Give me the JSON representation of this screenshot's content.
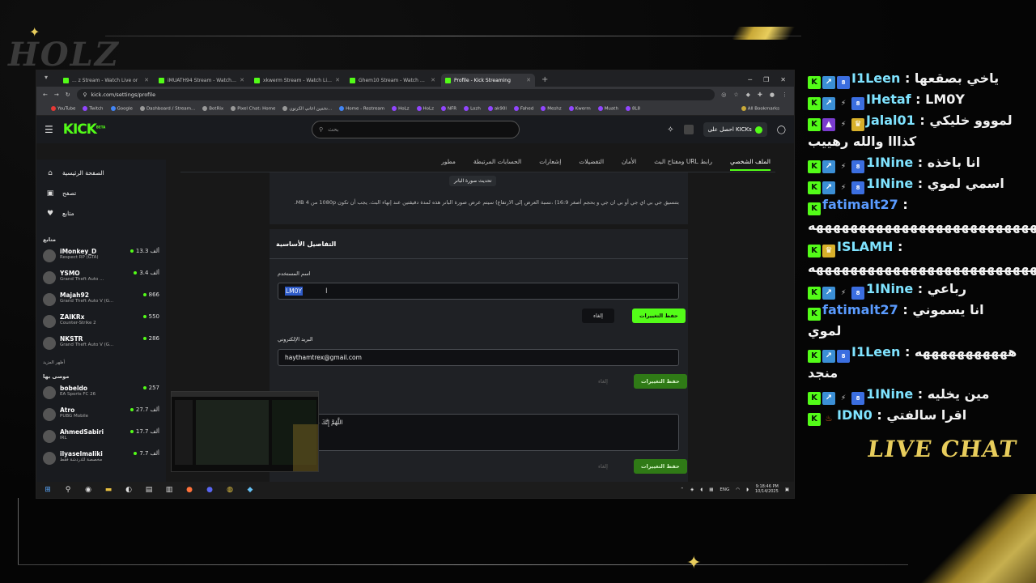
{
  "overlay": {
    "streamer_logo": "HOLZ",
    "live_chat_label": "LIVE CHAT",
    "accent_gold": "#e8cd5c"
  },
  "browser": {
    "tabs": [
      {
        "label": "... z Stream - Watch Live or",
        "active": false
      },
      {
        "label": "iMUATH94 Stream - Watch Live",
        "active": false
      },
      {
        "label": "xkwerm Stream - Watch Live o",
        "active": false
      },
      {
        "label": "Ghem10 Stream - Watch Live o",
        "active": false
      },
      {
        "label": "Profile - Kick Streaming",
        "active": true
      }
    ],
    "new_tab": "+",
    "url": "kick.com/settings/profile",
    "bookmarks": [
      "YouTube",
      "Twitch",
      "Google",
      "Dashboard / Stream...",
      "BotRix",
      "Pixel Chat: Home",
      "تخمين اغاني الكرتون...",
      "Home - Restream",
      "HoLz",
      "HoLz",
      "NFR",
      "Lozh",
      "ak90l",
      "Fahed",
      "Meshz",
      "Kwerm",
      "Muath",
      "8L8",
      "All Bookmarks"
    ]
  },
  "kick": {
    "logo": "KICK",
    "logo_sup": "BETA",
    "search_placeholder": "بحث",
    "get_kicks": "احصل على KICKs",
    "brand_color": "#53fc18",
    "sidebar": {
      "nav": [
        {
          "icon": "home-icon",
          "glyph": "⌂",
          "label": "الصفحة الرئيسية"
        },
        {
          "icon": "browse-icon",
          "glyph": "▣",
          "label": "تصفح"
        },
        {
          "icon": "following-icon",
          "glyph": "♥",
          "label": "متابع"
        }
      ],
      "following_title": "متابع",
      "following": [
        {
          "name": "iMonkey_D",
          "game": "Respect RP (GTA)",
          "viewers": "13.3 ألف"
        },
        {
          "name": "YSMO",
          "game": "Grand Theft Auto ...",
          "viewers": "3.4 ألف"
        },
        {
          "name": "Majah92",
          "game": "Grand Theft Auto V (G...",
          "viewers": "866"
        },
        {
          "name": "ZAIKRx",
          "game": "Counter-Strike 2",
          "viewers": "550"
        },
        {
          "name": "NKSTR",
          "game": "Grand Theft Auto V (G...",
          "viewers": "286"
        }
      ],
      "show_more": "أظهر المزيد",
      "recommended_title": "موصى بها",
      "recommended": [
        {
          "name": "bobeldo",
          "game": "EA Sports FC 26",
          "viewers": "257"
        },
        {
          "name": "Atro",
          "game": "PUBG Mobile",
          "viewers": "27.7 ألف"
        },
        {
          "name": "AhmedSabiri",
          "game": "IRL",
          "viewers": "17.7 ألف"
        },
        {
          "name": "ilyaselmaliki",
          "game": "مخصصة للدردشة فقط",
          "viewers": "7.7 ألف"
        }
      ]
    },
    "settings_tabs": [
      "الملف الشخصي",
      "رابط URL ومفتاح البث",
      "الأمان",
      "التفضيلات",
      "إشعارات",
      "الحسابات المرتبطة",
      "مطور"
    ],
    "profile": {
      "banner_tooltip": "تحديث صورة البانر",
      "banner_desc": "بتنسيق جي بي اي جي أو بي ان جي و بحجم أصغر 16:9) ،نسبة العرض إلى الارتفاع) سيتم عرض صورة البانر هذه لمدة دقيقتين عند إنهاء البث. يجب أن تكون 1080p من 4 MB.",
      "basic_title": "التفاصيل الأساسية",
      "username_label": "اسم المستخدم",
      "username_value": "LM0Y",
      "save_label": "حفظ التغييرات",
      "cancel_label": "إلغاء",
      "email_label": "البريد الإلكتروني",
      "email_value": "haythamtrex@gmail.com",
      "bio_value": "اللَّهُمَّ إِنَّكَ عَفُوٌّ كَرِيمٌ تُحِبُّ"
    }
  },
  "taskbar": {
    "lang": "ENG",
    "time": "9:18:46 PM",
    "date": "10/14/2025"
  },
  "chat": [
    {
      "user": "I1Leen",
      "text": "ياخي بصقعها",
      "badges": [
        "b1",
        "b2",
        "b3"
      ],
      "color": "teal"
    },
    {
      "user": "IHetaf",
      "text": "LM0Y",
      "badges": [
        "b1",
        "b2",
        "b7",
        "b3"
      ],
      "color": "teal"
    },
    {
      "user": "Jalal01",
      "text": "لمووو خليكي كذااا والله رهييب",
      "badges": [
        "b1",
        "b4",
        "b7",
        "b5"
      ],
      "color": "teal"
    },
    {
      "user": "1INine",
      "text": "انا باخذه",
      "badges": [
        "b1",
        "b2",
        "b7",
        "b3"
      ],
      "color": "teal"
    },
    {
      "user": "1INine",
      "text": "اسمي لموي",
      "badges": [
        "b1",
        "b2",
        "b7",
        "b3"
      ],
      "color": "teal"
    },
    {
      "user": "fatimalt27",
      "text": "هههههههههههههههههههههههههههههههه",
      "badges": [
        "b1"
      ],
      "color": "blue"
    },
    {
      "user": "ISLAMH",
      "text": "هههههههههههههههههههههههههههه",
      "badges": [
        "b1",
        "b5"
      ],
      "color": "teal"
    },
    {
      "user": "1INine",
      "text": "رباعي",
      "badges": [
        "b1",
        "b2",
        "b7",
        "b3"
      ],
      "color": "teal"
    },
    {
      "user": "fatimalt27",
      "text": "انا يسموني لموي",
      "badges": [
        "b1"
      ],
      "color": "blue"
    },
    {
      "user": "I1Leen",
      "text": "هههههههههههه منجد",
      "badges": [
        "b1",
        "b2",
        "b3"
      ],
      "color": "teal"
    },
    {
      "user": "1INine",
      "text": "مين يخليه",
      "badges": [
        "b1",
        "b2",
        "b7",
        "b3"
      ],
      "color": "teal"
    },
    {
      "user": "IDN0",
      "text": "اقرا سالفتي",
      "badges": [
        "b1",
        "b6"
      ],
      "color": "teal"
    }
  ]
}
